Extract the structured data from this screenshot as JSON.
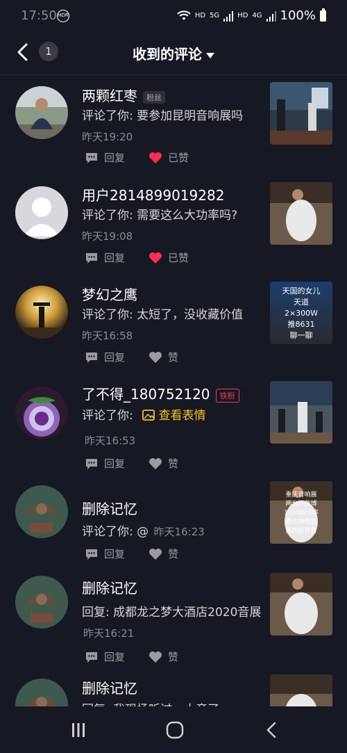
{
  "status_bar": {
    "time": "17:50",
    "badge": "HDR",
    "signal_labels": [
      "HD",
      "5G",
      "HD",
      "4G"
    ],
    "battery": "100%"
  },
  "header": {
    "unread_count": "1",
    "title": "收到的评论"
  },
  "actions_labels": {
    "reply": "回复",
    "liked": "已赞",
    "like": "赞"
  },
  "comments": [
    {
      "name": "两颗红枣",
      "tag": "粉丝",
      "comment": "评论了你: 要参加昆明音响展吗",
      "time": "昨天19:20",
      "liked": true
    },
    {
      "name": "用户2814899019282",
      "tag": "",
      "comment": "评论了你: 需要这么大功率吗?",
      "time": "昨天19:08",
      "liked": true
    },
    {
      "name": "梦幻之鹰",
      "tag": "",
      "comment": "评论了你: 太短了，没收藏价值",
      "time": "昨天16:58",
      "liked": false
    },
    {
      "name": "了不得_180752120",
      "tag": "铁粉",
      "comment": "评论了你:",
      "sticker": "查看表情",
      "time": "昨天16:53",
      "liked": false
    },
    {
      "name": "删除记忆",
      "tag": "",
      "comment": "评论了你: @",
      "time": "昨天16:23",
      "liked": false
    },
    {
      "name": "删除记忆",
      "tag": "",
      "comment": "回复: 成都龙之梦大酒店2020音展",
      "time": "昨天16:21",
      "liked": false
    },
    {
      "name": "删除记忆",
      "tag": "",
      "comment": "回复: 我现场听过，大音了",
      "time": "",
      "liked": false
    }
  ],
  "thumbnail_captions": {
    "item3": [
      "天国的女儿",
      "天道",
      "2×300W",
      "推8631",
      "聊一聊"
    ],
    "item2": [
      "重庆音响展",
      "两台开美博",
      "1000W功率",
      "要么你就想",
      "真的好开音"
    ]
  },
  "colors": {
    "background": "#161823",
    "liked_heart": "#fe2c55",
    "sticker": "#f5c518",
    "iron_fan": "#e4415c"
  }
}
